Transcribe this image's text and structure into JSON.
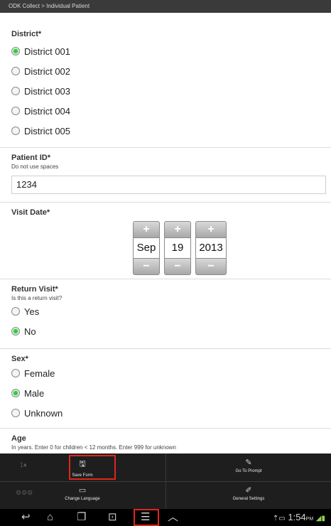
{
  "app_title": "ODK Collect > Individual Patient",
  "district": {
    "label": "District*",
    "options": [
      "District 001",
      "District 002",
      "District 003",
      "District 004",
      "District 005"
    ],
    "selected": "District 001"
  },
  "patient_id": {
    "label": "Patient ID*",
    "hint": "Do not use spaces",
    "value": "1234"
  },
  "visit_date": {
    "label": "Visit Date*",
    "month": "Sep",
    "day": "19",
    "year": "2013"
  },
  "return_visit": {
    "label": "Return Visit*",
    "hint": "Is this a return visit?",
    "options": [
      "Yes",
      "No"
    ],
    "selected": "No"
  },
  "sex": {
    "label": "Sex*",
    "options": [
      "Female",
      "Male",
      "Unknown"
    ],
    "selected": "Male"
  },
  "age": {
    "label": "Age",
    "hint": "In years. Enter 0 for children < 12 months. Enter 999 for unknown"
  },
  "menu": {
    "save_form": "Save Form",
    "go_to_prompt": "Go To Prompt",
    "change_language": "Change Language",
    "general_settings": "General Settings"
  },
  "status_bar": {
    "time": "1:54",
    "ampm": "PM"
  },
  "highlight_color": "#e0261b",
  "radio_on_color": "#2ccf3b"
}
